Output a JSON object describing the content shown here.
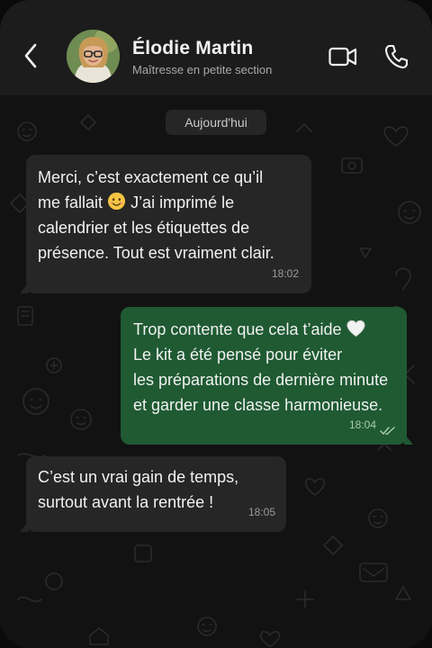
{
  "header": {
    "contact_name": "Élodie Martin",
    "contact_subtitle": "Maîtresse en petite section",
    "back_icon": "chevron-left-icon",
    "video_icon": "video-camera-icon",
    "call_icon": "phone-icon"
  },
  "chat": {
    "date_label": "Aujourd'hui",
    "messages": [
      {
        "direction": "incoming",
        "lines": [
          "Merci, c’est exactement ce qu’il",
          "me fallait",
          "calendrier et les étiquettes de",
          "présence. Tout est vraiment clair."
        ],
        "line2_suffix": "J’ai imprimé le",
        "time": "18:02"
      },
      {
        "direction": "outgoing",
        "lines": [
          "Trop contente que cela t’aide",
          "Le kit a été pensé pour éviter",
          "les préparations de dernière minute",
          "et garder une classe harmonieuse."
        ],
        "time": "18:04",
        "status": "read"
      },
      {
        "direction": "incoming",
        "lines": [
          "C’est un vrai gain de temps,",
          "surtout avant la rentrée !"
        ],
        "time": "18:05"
      }
    ]
  },
  "colors": {
    "incoming_bubble": "#262626",
    "outgoing_bubble": "#1f5a33",
    "header_bg": "#1c1c1c"
  }
}
